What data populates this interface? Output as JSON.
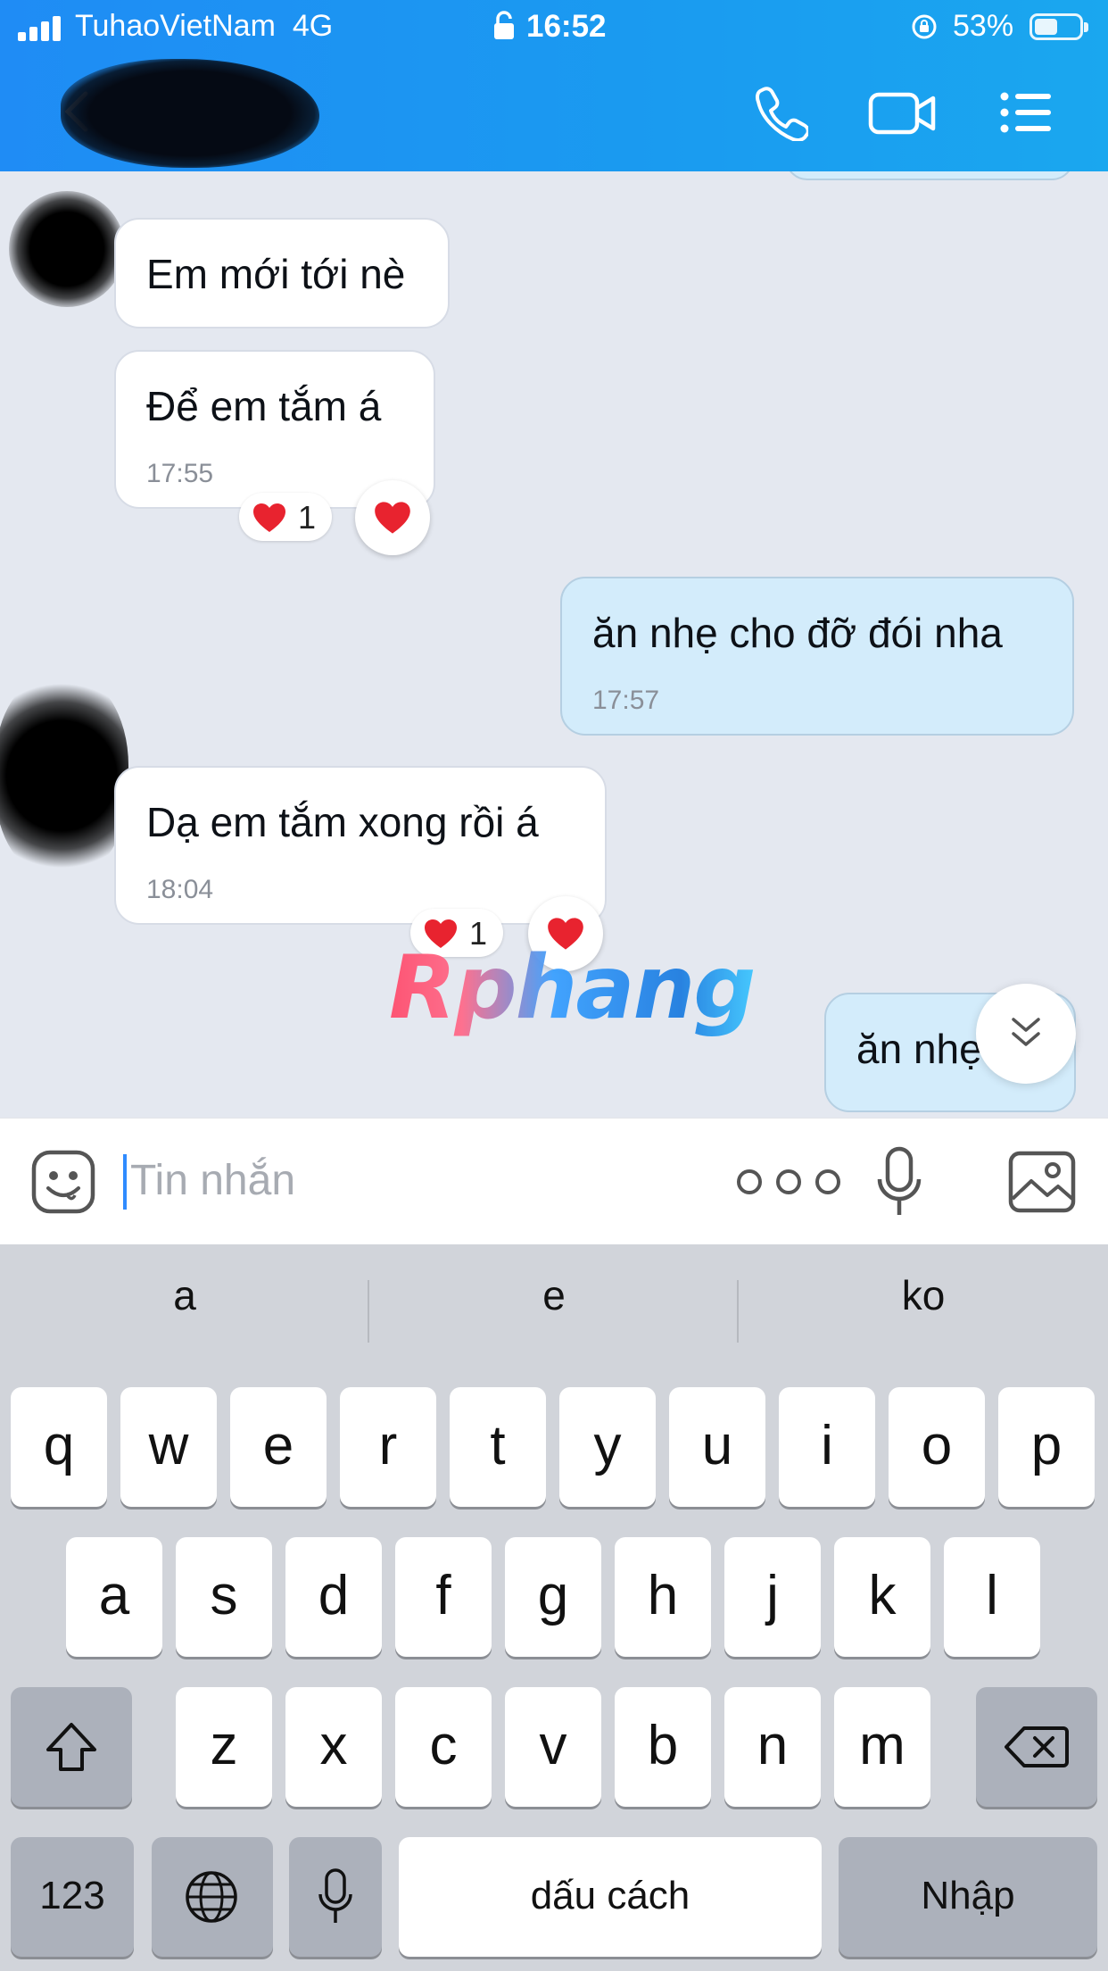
{
  "status_bar": {
    "carrier": "TuhaoVietNam",
    "network": "4G",
    "time": "16:52",
    "battery": "53%",
    "battery_level": 0.53
  },
  "chat": {
    "messages": [
      {
        "direction": "incoming",
        "text": "Em mới tới nè",
        "time": ""
      },
      {
        "direction": "incoming",
        "text": "Để em tắm á",
        "time": "17:55",
        "reaction_count": "1"
      },
      {
        "direction": "outgoing",
        "text": "ăn nhẹ cho đỡ đói nha",
        "time": "17:57"
      },
      {
        "direction": "incoming",
        "text": "Dạ em tắm xong rồi á",
        "time": "18:04",
        "reaction_count": "1"
      },
      {
        "direction": "outgoing",
        "text": "ăn nhẹ",
        "time": ""
      }
    ],
    "watermark": "Rphang"
  },
  "input": {
    "placeholder": "Tin nhắn"
  },
  "keyboard": {
    "suggestions": [
      "a",
      "e",
      "ko"
    ],
    "row1": [
      "q",
      "w",
      "e",
      "r",
      "t",
      "y",
      "u",
      "i",
      "o",
      "p"
    ],
    "row2": [
      "a",
      "s",
      "d",
      "f",
      "g",
      "h",
      "j",
      "k",
      "l"
    ],
    "row3": [
      "z",
      "x",
      "c",
      "v",
      "b",
      "n",
      "m"
    ],
    "numbers_label": "123",
    "space_label": "dấu cách",
    "return_label": "Nhập"
  },
  "colors": {
    "header_blue": "#1f8cf5",
    "outgoing_bubble": "#d3ecfb",
    "chat_background": "#e4e8f0",
    "reaction_heart": "#e8232f"
  },
  "icons": [
    "signal-icon",
    "lock-icon",
    "rotation-lock-icon",
    "battery-icon",
    "back-icon",
    "phone-icon",
    "video-call-icon",
    "menu-icon",
    "heart-icon",
    "chevron-down-icon",
    "sticker-icon",
    "more-icon",
    "microphone-icon",
    "image-icon",
    "shift-icon",
    "backspace-icon",
    "globe-icon"
  ]
}
